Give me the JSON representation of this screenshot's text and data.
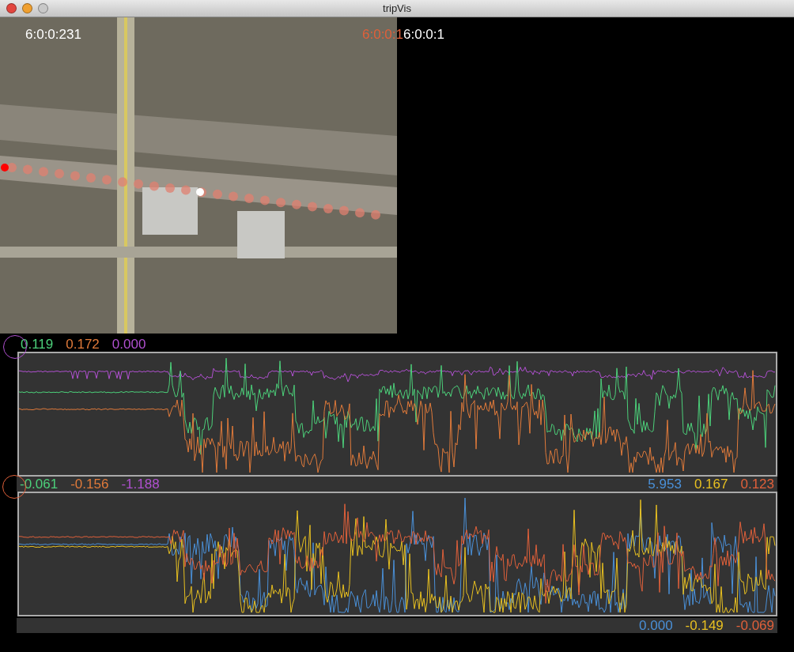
{
  "window": {
    "title": "tripVis",
    "buttons": [
      {
        "kind": "close"
      },
      {
        "kind": "minimize"
      },
      {
        "kind": "zoom"
      }
    ]
  },
  "map": {
    "time_labels": [
      {
        "text": "6:0:0:231",
        "color": "#ffffff"
      },
      {
        "text": "6:0:0:1",
        "color": "#e0603a"
      },
      {
        "text": "6:0:0:1",
        "color": "#ffffff"
      }
    ]
  },
  "charts": [
    {
      "color": "#b050d0",
      "readouts_left": [
        {
          "text": "0.119",
          "color": "#4cd07a"
        },
        {
          "text": "0.172",
          "color": "#e07a3a"
        },
        {
          "text": "0.000",
          "color": "#b050d0"
        }
      ],
      "traces": [
        {
          "color": "#b050d0"
        },
        {
          "color": "#4cd07a"
        },
        {
          "color": "#e07a3a"
        }
      ]
    },
    {
      "color": "#e0603a",
      "readouts_left": [
        {
          "text": "-0.061",
          "color": "#4cd07a"
        },
        {
          "text": "-0.156",
          "color": "#e07a3a"
        },
        {
          "text": "-1.188",
          "color": "#b050d0"
        }
      ],
      "readouts_right": [
        {
          "text": "5.953",
          "color": "#4a90d8"
        },
        {
          "text": "0.167",
          "color": "#e8c020"
        },
        {
          "text": "0.123",
          "color": "#e0603a"
        }
      ],
      "readouts_bottom": [
        {
          "text": "0.000",
          "color": "#4a90d8"
        },
        {
          "text": "-0.149",
          "color": "#e8c020"
        },
        {
          "text": "-0.069",
          "color": "#e0603a"
        }
      ],
      "traces": [
        {
          "color": "#4a90d8"
        },
        {
          "color": "#e8c020"
        },
        {
          "color": "#e0603a"
        }
      ]
    }
  ]
}
